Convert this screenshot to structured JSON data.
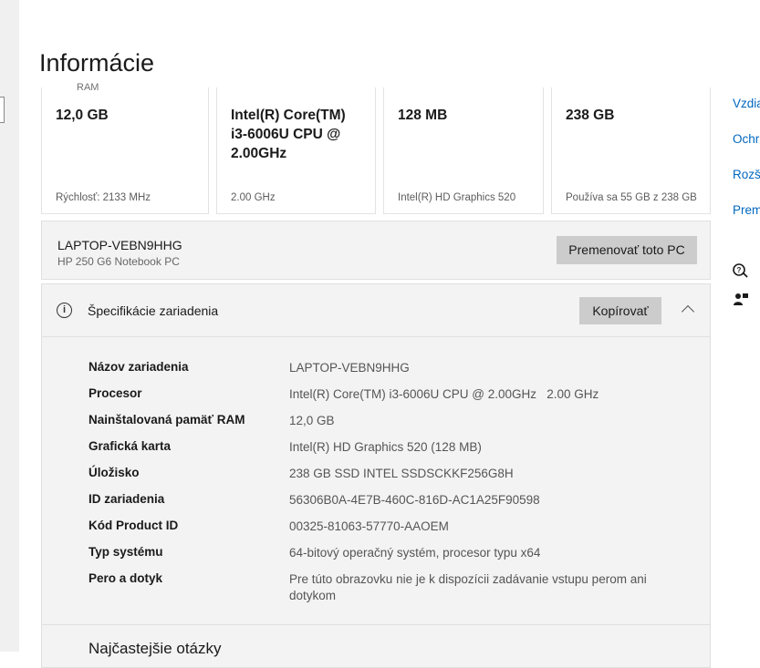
{
  "page": {
    "title": "Informácie"
  },
  "spec_cards": [
    {
      "value": "12,0 GB",
      "sub": "Rýchlosť: 2133 MHz",
      "cut_label": "RAM"
    },
    {
      "value": "Intel(R) Core(TM) i3-6006U CPU @ 2.00GHz",
      "sub": "2.00 GHz"
    },
    {
      "value": "128 MB",
      "sub": "Intel(R) HD Graphics 520"
    },
    {
      "value": "238 GB",
      "sub": "Používa sa 55 GB z 238 GB"
    }
  ],
  "pc": {
    "name": "LAPTOP-VEBN9HHG",
    "model": "HP 250 G6 Notebook PC",
    "rename_label": "Premenovať toto PC"
  },
  "device_spec": {
    "title": "Špecifikácie zariadenia",
    "copy_label": "Kopírovať",
    "rows": [
      {
        "key": "Názov zariadenia",
        "value": "LAPTOP-VEBN9HHG"
      },
      {
        "key": "Procesor",
        "value": "Intel(R) Core(TM) i3-6006U CPU @ 2.00GHz   2.00 GHz"
      },
      {
        "key": "Nainštalovaná pamäť RAM",
        "value": "12,0 GB"
      },
      {
        "key": "Grafická karta",
        "value": "Intel(R) HD Graphics 520 (128 MB)"
      },
      {
        "key": "Úložisko",
        "value": "238 GB SSD INTEL SSDSCKKF256G8H"
      },
      {
        "key": "ID zariadenia",
        "value": "56306B0A-4E7B-460C-816D-AC1A25F90598"
      },
      {
        "key": "Kód Product ID",
        "value": "00325-81063-57770-AAOEM"
      },
      {
        "key": "Typ systému",
        "value": "64-bitový operačný systém, procesor typu x64"
      },
      {
        "key": "Pero a dotyk",
        "value": "Pre túto obrazovku nie je k dispozícii zadávanie vstupu perom ani dotykom"
      }
    ]
  },
  "faq": {
    "title": "Najčastejšie otázky"
  },
  "right_links": [
    "Vzdia",
    "Ochr",
    "Rozš",
    "Prem"
  ],
  "icons": {
    "info": "info-icon",
    "chevron": "chevron-up-icon",
    "help": "help-chat-icon",
    "feedback": "feedback-person-icon"
  },
  "colors": {
    "link": "#0067c0",
    "panel": "#f3f3f3",
    "button": "#cccccc"
  }
}
